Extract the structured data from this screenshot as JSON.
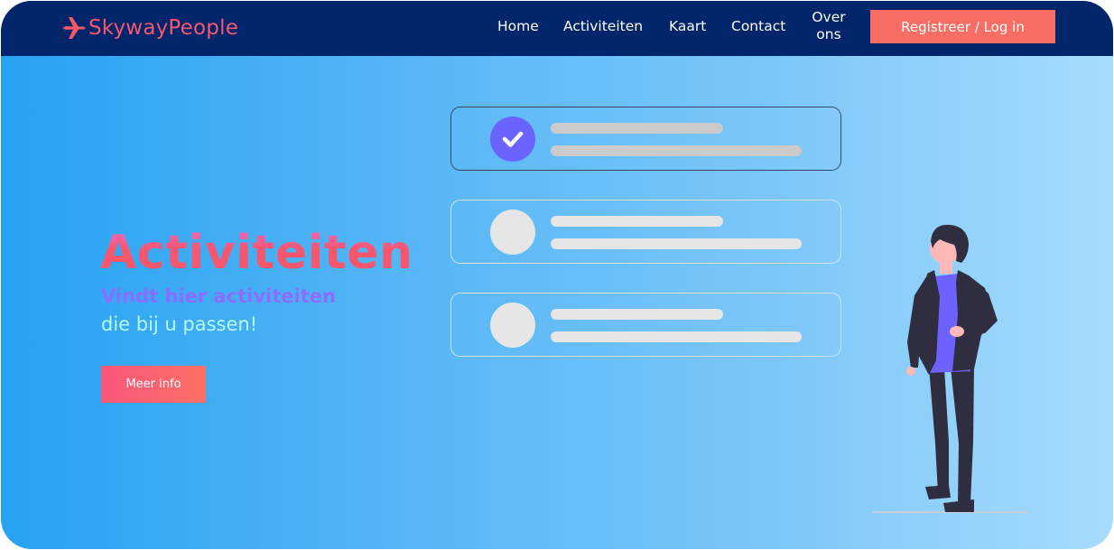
{
  "brand": {
    "name": "SkywayPeople",
    "color": "#f7576b",
    "icon": "airplane-icon"
  },
  "nav": {
    "home": "Home",
    "activiteiten": "Activiteiten",
    "kaart": "Kaart",
    "contact": "Contact",
    "over_ons": "Over ons",
    "register_login": "Registreer / Log in"
  },
  "hero": {
    "title": "Activiteiten",
    "subtitle_line1": "Vindt hier activiteiten",
    "subtitle_line2": "die bij u passen!",
    "cta": "Meer info"
  },
  "illustration": {
    "cards": [
      {
        "state": "checked",
        "icon": "checkmark-icon"
      },
      {
        "state": "unchecked"
      },
      {
        "state": "unchecked"
      }
    ],
    "figure": "standing-person-illustration"
  },
  "colors": {
    "navbar": "#01256a",
    "accent": "#f96e64",
    "check": "#6b63ff",
    "gradient_start": "#27a2f3",
    "gradient_end": "#a7dcfc"
  }
}
